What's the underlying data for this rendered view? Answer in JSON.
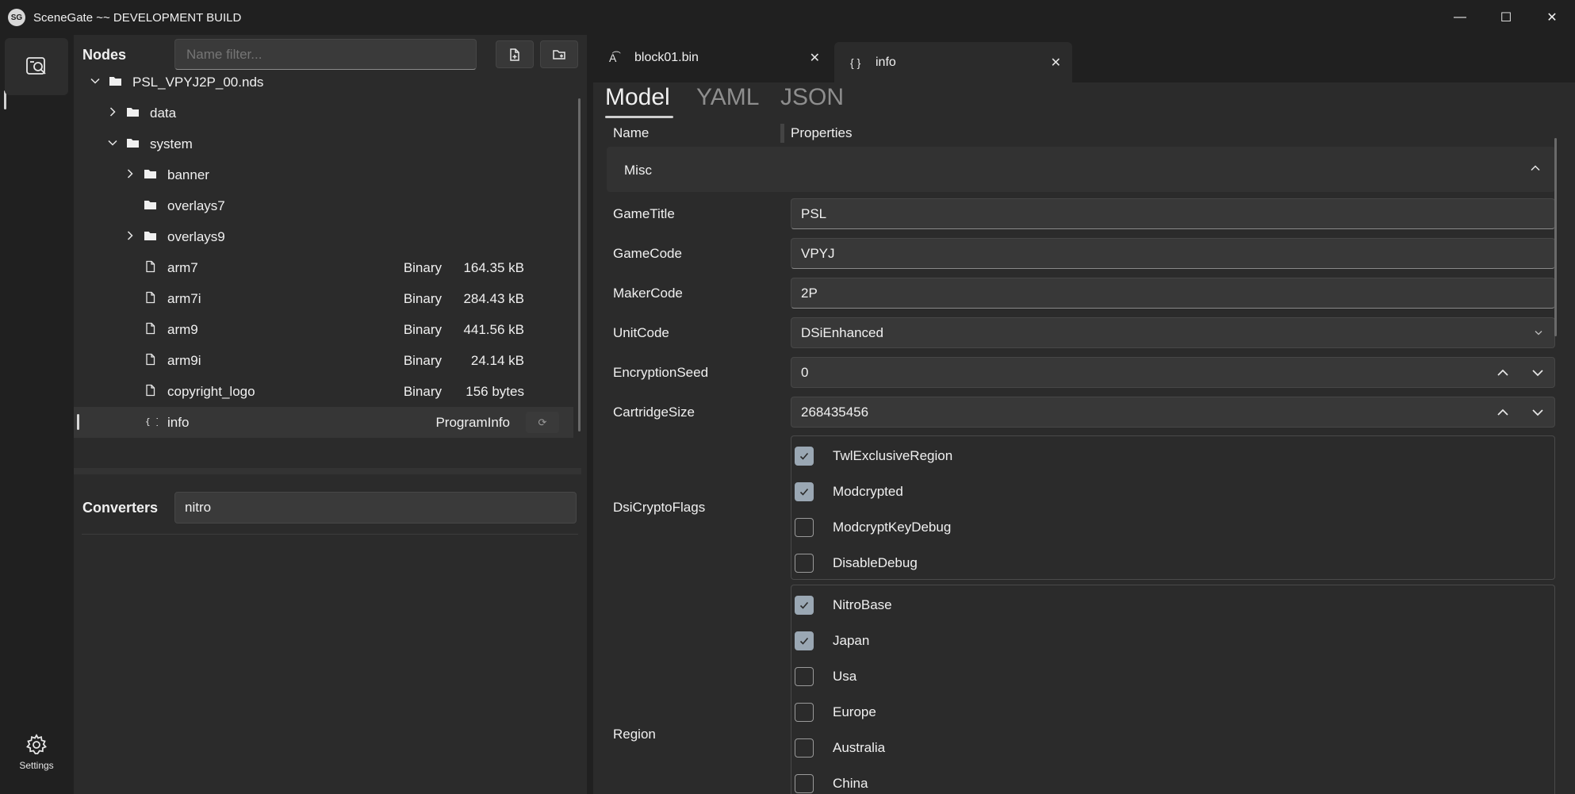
{
  "window": {
    "logo": "SG",
    "title": "SceneGate ~~ DEVELOPMENT BUILD",
    "minimize": "—",
    "maximize": "☐",
    "close": "✕"
  },
  "rail": {
    "settings_label": "Settings"
  },
  "nodes": {
    "title": "Nodes",
    "filter_placeholder": "Name filter...",
    "tree": [
      {
        "label": "PSL_VPYJ2P_00.nds",
        "type": "",
        "size": "",
        "icon": "folder-icon",
        "expander": "expanded"
      },
      {
        "label": "data",
        "type": "",
        "size": "",
        "icon": "folder-icon",
        "expander": "collapsed"
      },
      {
        "label": "system",
        "type": "",
        "size": "",
        "icon": "folder-icon",
        "expander": "expanded"
      },
      {
        "label": "banner",
        "type": "",
        "size": "",
        "icon": "folder-icon",
        "expander": "collapsed"
      },
      {
        "label": "overlays7",
        "type": "",
        "size": "",
        "icon": "folder-icon",
        "expander": "none"
      },
      {
        "label": "overlays9",
        "type": "",
        "size": "",
        "icon": "folder-icon",
        "expander": "collapsed"
      },
      {
        "label": "arm7",
        "type": "Binary",
        "size": "164.35 kB",
        "icon": "file-icon",
        "expander": "none"
      },
      {
        "label": "arm7i",
        "type": "Binary",
        "size": "284.43 kB",
        "icon": "file-icon",
        "expander": "none"
      },
      {
        "label": "arm9",
        "type": "Binary",
        "size": "441.56 kB",
        "icon": "file-icon",
        "expander": "none"
      },
      {
        "label": "arm9i",
        "type": "Binary",
        "size": "24.14 kB",
        "icon": "file-icon",
        "expander": "none"
      },
      {
        "label": "copyright_logo",
        "type": "Binary",
        "size": "156 bytes",
        "icon": "file-icon",
        "expander": "none"
      },
      {
        "label": "info",
        "type": "ProgramInfo",
        "size": "",
        "icon": "braces-icon",
        "expander": "none",
        "selected": true
      }
    ]
  },
  "converters": {
    "title": "Converters",
    "filter_value": "nitro"
  },
  "tabs": [
    {
      "label": "block01.bin",
      "icon": "text-file-icon",
      "active": false
    },
    {
      "label": "info",
      "icon": "braces-icon",
      "active": true
    }
  ],
  "view_tabs": [
    {
      "label": "Model",
      "active": true
    },
    {
      "label": "YAML",
      "active": false
    },
    {
      "label": "JSON",
      "active": false
    }
  ],
  "grid": {
    "name_header": "Name",
    "properties_header": "Properties",
    "section_title": "Misc",
    "fields": {
      "game_title": {
        "label": "GameTitle",
        "value": "PSL"
      },
      "game_code": {
        "label": "GameCode",
        "value": "VPYJ"
      },
      "maker_code": {
        "label": "MakerCode",
        "value": "2P"
      },
      "unit_code": {
        "label": "UnitCode",
        "value": "DSiEnhanced"
      },
      "encryption_seed": {
        "label": "EncryptionSeed",
        "value": "0"
      },
      "cartridge_size": {
        "label": "CartridgeSize",
        "value": "268435456"
      }
    },
    "dsi_crypto_flags": {
      "label": "DsiCryptoFlags",
      "options": [
        {
          "label": "TwlExclusiveRegion",
          "checked": true
        },
        {
          "label": "Modcrypted",
          "checked": true
        },
        {
          "label": "ModcryptKeyDebug",
          "checked": false
        },
        {
          "label": "DisableDebug",
          "checked": false
        }
      ]
    },
    "region": {
      "label": "Region",
      "options": [
        {
          "label": "NitroBase",
          "checked": true
        },
        {
          "label": "Japan",
          "checked": true
        },
        {
          "label": "Usa",
          "checked": false
        },
        {
          "label": "Europe",
          "checked": false
        },
        {
          "label": "Australia",
          "checked": false
        },
        {
          "label": "China",
          "checked": false
        }
      ]
    }
  }
}
